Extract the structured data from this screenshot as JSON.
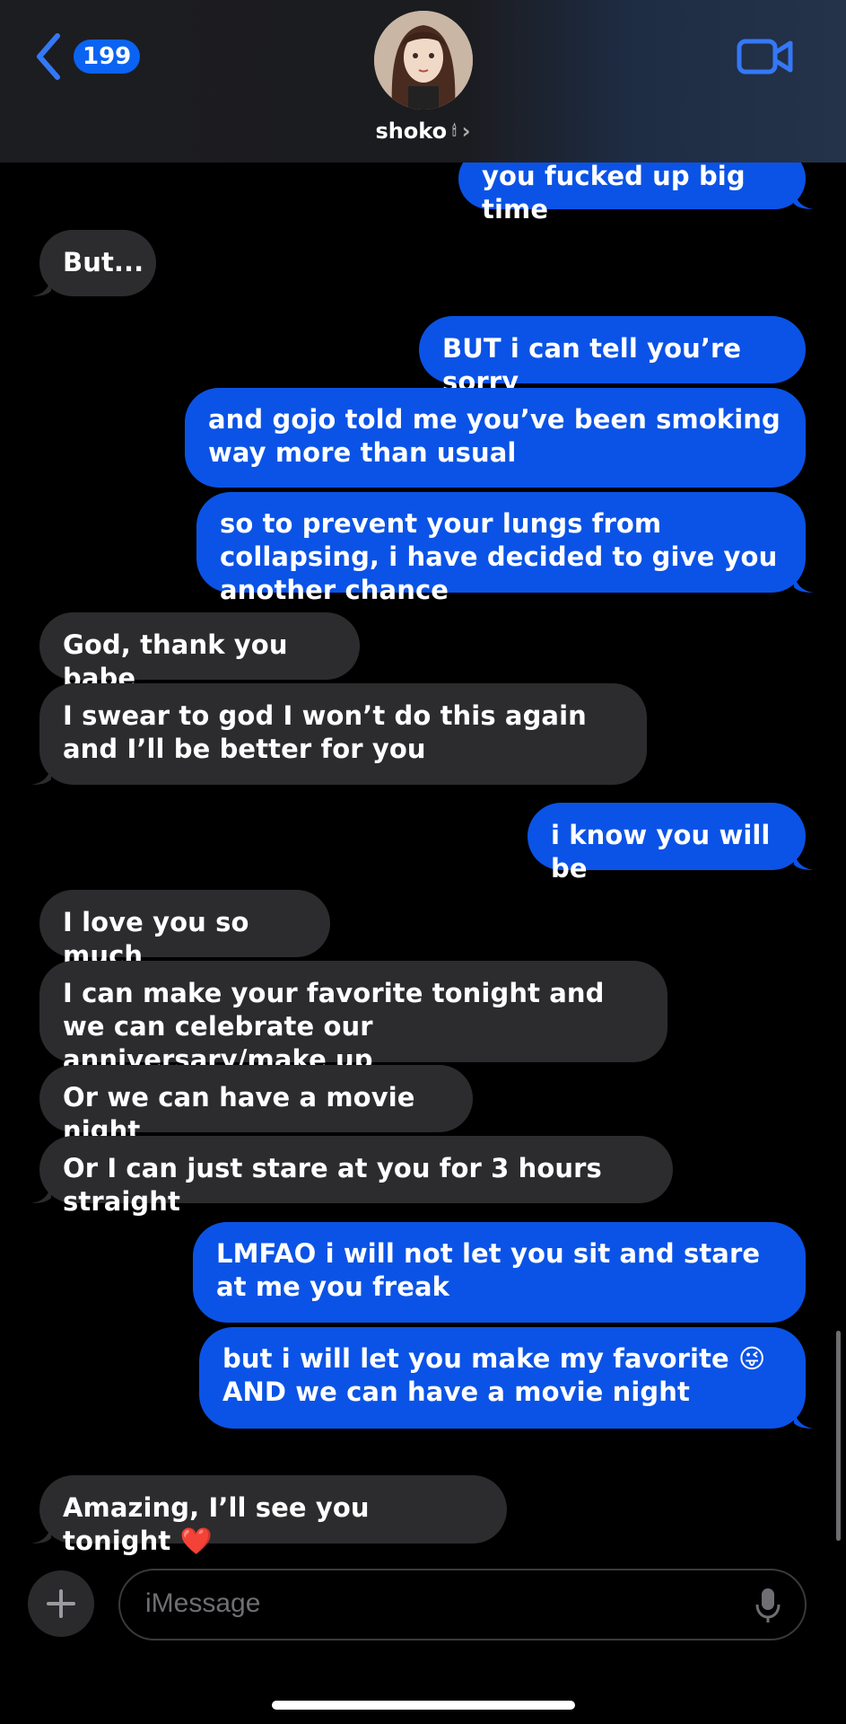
{
  "header": {
    "unread_count": "199",
    "contact_name": "shoko",
    "contact_emoji": "🕯"
  },
  "messages": [
    {
      "from": "me",
      "text": "you fucked up big time"
    },
    {
      "from": "them",
      "text": "But..."
    },
    {
      "from": "me",
      "text": "BUT i can tell you’re sorry"
    },
    {
      "from": "me",
      "text": "and gojo told me you’ve been smoking way more than usual"
    },
    {
      "from": "me",
      "text": "so to prevent your lungs from collapsing, i have decided to give you another chance"
    },
    {
      "from": "them",
      "text": "God, thank you babe"
    },
    {
      "from": "them",
      "text": "I swear to god I won’t do this again and I’ll be better for you"
    },
    {
      "from": "me",
      "text": "i know you will be"
    },
    {
      "from": "them",
      "text": "I love you so much"
    },
    {
      "from": "them",
      "text": "I can make your favorite tonight and we can celebrate our anniversary/make up"
    },
    {
      "from": "them",
      "text": "Or we can have a movie night"
    },
    {
      "from": "them",
      "text": "Or I can just stare at you for 3 hours straight"
    },
    {
      "from": "me",
      "text": "LMFAO i will not let you sit and stare at me you freak"
    },
    {
      "from": "me",
      "text": "but i will let you make my favorite 😜 AND we can have a movie night"
    },
    {
      "from": "them",
      "text": "Amazing, I’ll see you tonight ❤️"
    }
  ],
  "composer": {
    "placeholder": "iMessage"
  },
  "colors": {
    "sent_bubble": "#0b53e6",
    "received_bubble": "#2c2c2e",
    "badge": "#0a63f2",
    "accent": "#3478f6"
  }
}
